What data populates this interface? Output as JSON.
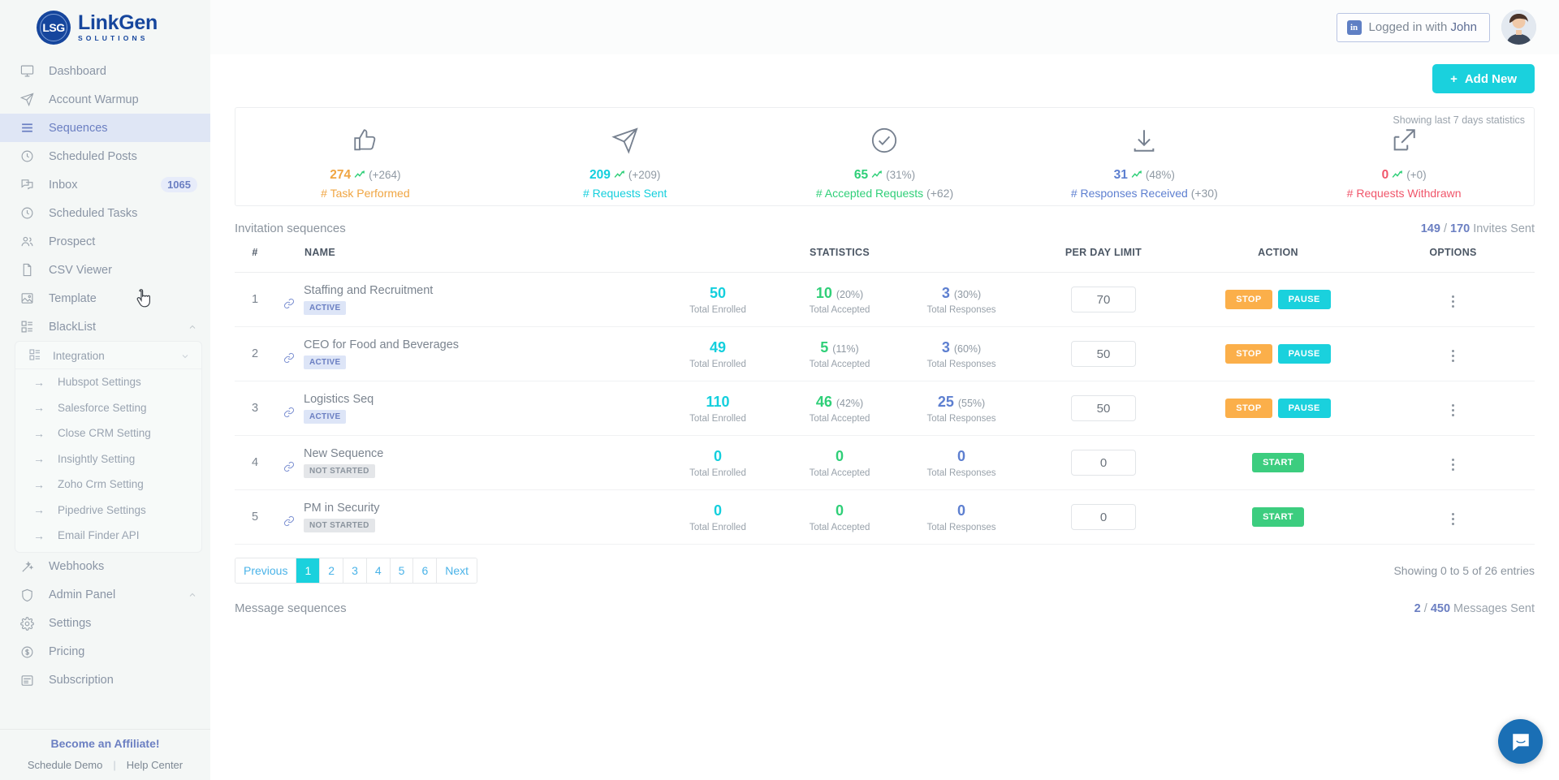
{
  "brand": {
    "mark": "LSG",
    "name": "LinkGen",
    "sub": "SOLUTIONS"
  },
  "sidebar": {
    "items": [
      {
        "label": "Dashboard",
        "icon": "monitor-icon"
      },
      {
        "label": "Account Warmup",
        "icon": "paper-plane-icon"
      },
      {
        "label": "Sequences",
        "icon": "list-icon",
        "active": true
      },
      {
        "label": "Scheduled Posts",
        "icon": "clock-icon"
      },
      {
        "label": "Inbox",
        "icon": "chat-icon",
        "badge": "1065"
      },
      {
        "label": "Scheduled Tasks",
        "icon": "clock-icon"
      },
      {
        "label": "Prospect",
        "icon": "users-icon"
      },
      {
        "label": "CSV Viewer",
        "icon": "file-icon"
      },
      {
        "label": "Template",
        "icon": "image-icon"
      },
      {
        "label": "BlackList",
        "icon": "grid-icon",
        "expanded": true
      }
    ],
    "integration": {
      "label": "Integration",
      "icon": "grid-icon",
      "items": [
        {
          "label": "Hubspot Settings"
        },
        {
          "label": "Salesforce Setting"
        },
        {
          "label": "Close CRM Setting"
        },
        {
          "label": "Insightly Setting"
        },
        {
          "label": "Zoho Crm Setting"
        },
        {
          "label": "Pipedrive Settings"
        },
        {
          "label": "Email Finder API"
        }
      ]
    },
    "items_after": [
      {
        "label": "Webhooks",
        "icon": "wand-icon"
      },
      {
        "label": "Admin Panel",
        "icon": "shield-icon",
        "expanded": true
      },
      {
        "label": "Settings",
        "icon": "gear-icon"
      },
      {
        "label": "Pricing",
        "icon": "dollar-icon"
      },
      {
        "label": "Subscription",
        "icon": "card-icon"
      }
    ],
    "footer": {
      "affiliate": "Become an Affiliate!",
      "schedule_demo": "Schedule Demo",
      "help_center": "Help Center",
      "separator": "|"
    }
  },
  "topbar": {
    "login_label": "Logged in with",
    "login_user": "John",
    "linkedin_icon": "in"
  },
  "toolbar": {
    "add_new_label": "Add New",
    "add_new_plus": "+"
  },
  "stats": {
    "showing_note": "Showing last 7 days statistics",
    "items": [
      {
        "icon": "thumbs-up-icon",
        "value": "274",
        "paren": "(+264)",
        "label": "# Task Performed",
        "delta": "",
        "color": "#f0a542"
      },
      {
        "icon": "paper-plane-icon",
        "value": "209",
        "paren": "(+209)",
        "label": "# Requests Sent",
        "delta": "",
        "color": "#14cfdd"
      },
      {
        "icon": "check-circle-icon",
        "value": "65",
        "paren": "(31%)",
        "label": "# Accepted Requests",
        "delta": "(+62)",
        "color": "#2fcf78"
      },
      {
        "icon": "download-icon",
        "value": "31",
        "paren": "(48%)",
        "label": "# Responses Received",
        "delta": "(+30)",
        "color": "#5d7fd0"
      },
      {
        "icon": "external-link-icon",
        "value": "0",
        "paren": "(+0)",
        "label": "# Requests Withdrawn",
        "delta": "",
        "color": "#f0556a"
      }
    ]
  },
  "invitation": {
    "title": "Invitation sequences",
    "invites_sent_a": "149",
    "invites_sent_sep": "/",
    "invites_sent_b": "170",
    "invites_sent_label": "Invites Sent",
    "columns": {
      "num": "#",
      "name": "NAME",
      "statistics": "STATISTICS",
      "per_day_limit": "PER DAY LIMIT",
      "action": "ACTION",
      "options": "OPTIONS"
    },
    "stat_labels": {
      "enrolled": "Total Enrolled",
      "accepted": "Total Accepted",
      "responses": "Total Responses"
    },
    "rows": [
      {
        "num": "1",
        "name": "Staffing and Recruitment",
        "status": "ACTIVE",
        "status_kind": "active",
        "enrolled": "50",
        "enrolled_pct": "",
        "accepted": "10",
        "accepted_pct": "(20%)",
        "responses": "3",
        "responses_pct": "(30%)",
        "limit": "70",
        "actions": [
          {
            "label": "STOP",
            "kind": "stop"
          },
          {
            "label": "PAUSE",
            "kind": "pause"
          }
        ]
      },
      {
        "num": "2",
        "name": "CEO for Food and Beverages",
        "status": "ACTIVE",
        "status_kind": "active",
        "enrolled": "49",
        "enrolled_pct": "",
        "accepted": "5",
        "accepted_pct": "(11%)",
        "responses": "3",
        "responses_pct": "(60%)",
        "limit": "50",
        "actions": [
          {
            "label": "STOP",
            "kind": "stop"
          },
          {
            "label": "PAUSE",
            "kind": "pause"
          }
        ]
      },
      {
        "num": "3",
        "name": "Logistics Seq",
        "status": "ACTIVE",
        "status_kind": "active",
        "enrolled": "110",
        "enrolled_pct": "",
        "accepted": "46",
        "accepted_pct": "(42%)",
        "responses": "25",
        "responses_pct": "(55%)",
        "limit": "50",
        "actions": [
          {
            "label": "STOP",
            "kind": "stop"
          },
          {
            "label": "PAUSE",
            "kind": "pause"
          }
        ]
      },
      {
        "num": "4",
        "name": "New Sequence",
        "status": "NOT STARTED",
        "status_kind": "notstarted",
        "enrolled": "0",
        "enrolled_pct": "",
        "accepted": "0",
        "accepted_pct": "",
        "responses": "0",
        "responses_pct": "",
        "limit": "0",
        "actions": [
          {
            "label": "START",
            "kind": "start"
          }
        ]
      },
      {
        "num": "5",
        "name": "PM in Security",
        "status": "NOT STARTED",
        "status_kind": "notstarted",
        "enrolled": "0",
        "enrolled_pct": "",
        "accepted": "0",
        "accepted_pct": "",
        "responses": "0",
        "responses_pct": "",
        "limit": "0",
        "actions": [
          {
            "label": "START",
            "kind": "start"
          }
        ]
      }
    ],
    "pagination": {
      "previous": "Previous",
      "next": "Next",
      "pages": [
        "1",
        "2",
        "3",
        "4",
        "5",
        "6"
      ],
      "current": "1"
    },
    "entries": "Showing 0 to 5 of 26 entries"
  },
  "message": {
    "title": "Message sequences",
    "sent_a": "2",
    "sent_sep": "/",
    "sent_b": "450",
    "sent_label": "Messages Sent"
  },
  "chat": {
    "icon": "chat-bubble-icon"
  },
  "colors": {
    "accent": "#1ad1dd",
    "brand": "#16469d",
    "sidebar_bg": "#f4f7f6",
    "active_nav": "#dfe6f5",
    "stop": "#fbaf4a",
    "start": "#3ccd7f"
  }
}
